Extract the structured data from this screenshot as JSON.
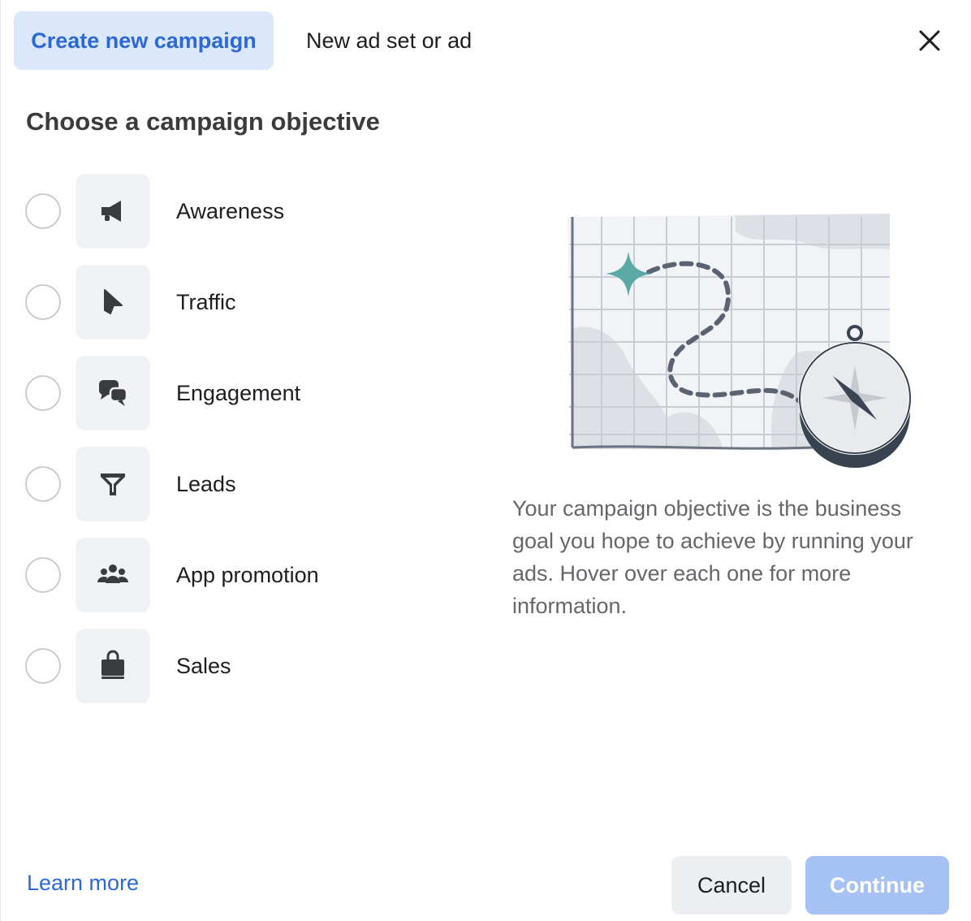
{
  "header": {
    "tabs": [
      {
        "label": "Create new campaign",
        "active": true
      },
      {
        "label": "New ad set or ad",
        "active": false
      }
    ],
    "close_icon": "close-icon"
  },
  "main": {
    "title": "Choose a campaign objective",
    "objectives": [
      {
        "label": "Awareness",
        "icon": "megaphone-icon",
        "selected": false
      },
      {
        "label": "Traffic",
        "icon": "cursor-icon",
        "selected": false
      },
      {
        "label": "Engagement",
        "icon": "chat-bubbles-icon",
        "selected": false
      },
      {
        "label": "Leads",
        "icon": "filter-icon",
        "selected": false
      },
      {
        "label": "App promotion",
        "icon": "people-icon",
        "selected": false
      },
      {
        "label": "Sales",
        "icon": "shopping-bag-icon",
        "selected": false
      }
    ],
    "description": "Your campaign objective is the business goal you hope to achieve by running your ads. Hover over each one for more information."
  },
  "footer": {
    "learn_more": "Learn more",
    "cancel_label": "Cancel",
    "continue_label": "Continue",
    "continue_enabled": false
  },
  "colors": {
    "accent": "#2d68d8",
    "tab_active_bg": "#dbe7fb",
    "continue_disabled_bg": "#a6c1f4",
    "star_teal": "#5aa9a6"
  }
}
